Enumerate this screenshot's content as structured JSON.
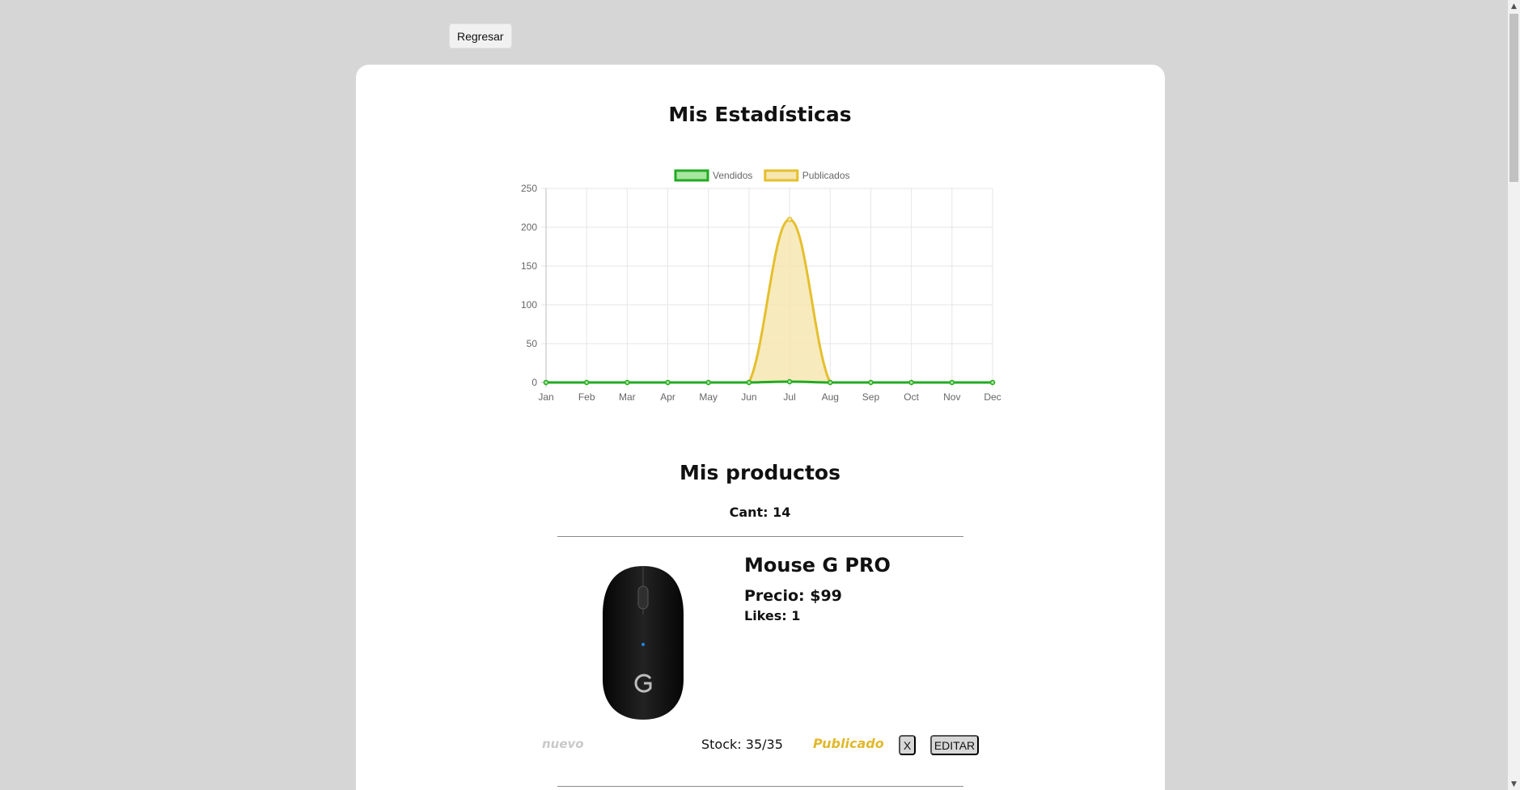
{
  "header": {
    "back_label": "Regresar"
  },
  "stats": {
    "title": "Mis Estadísticas"
  },
  "chart_data": {
    "type": "area",
    "categories": [
      "Jan",
      "Feb",
      "Mar",
      "Apr",
      "May",
      "Jun",
      "Jul",
      "Aug",
      "Sep",
      "Oct",
      "Nov",
      "Dec"
    ],
    "series": [
      {
        "name": "Vendidos",
        "values": [
          0,
          0,
          0,
          0,
          0,
          0,
          1,
          0,
          0,
          0,
          0,
          0
        ],
        "color": "#22aa22",
        "fill": "#a8e6a0"
      },
      {
        "name": "Publicados",
        "values": [
          0,
          0,
          0,
          0,
          0,
          0,
          210,
          0,
          0,
          0,
          0,
          0
        ],
        "color": "#e5bf2e",
        "fill": "#f6e6b0"
      }
    ],
    "yticks": [
      "0",
      "50",
      "100",
      "150",
      "200",
      "250"
    ],
    "ylim": [
      0,
      250
    ],
    "grid": true,
    "legend": "top"
  },
  "products": {
    "title": "Mis productos",
    "count_label": "Cant: 14",
    "items": [
      {
        "name": "Mouse G PRO",
        "price": "Precio: $99",
        "likes": "Likes: 1",
        "condition": "nuevo",
        "stock": "Stock: 35/35",
        "status": "Publicado",
        "delete_label": "X",
        "edit_label": "EDITAR"
      }
    ]
  },
  "colors": {
    "background": "#d6d6d6",
    "card": "#ffffff",
    "status_published": "#e2b82b",
    "condition_text": "#c9c9c9"
  },
  "icons": {
    "scroll_up": "▲",
    "scroll_down": "▼"
  }
}
